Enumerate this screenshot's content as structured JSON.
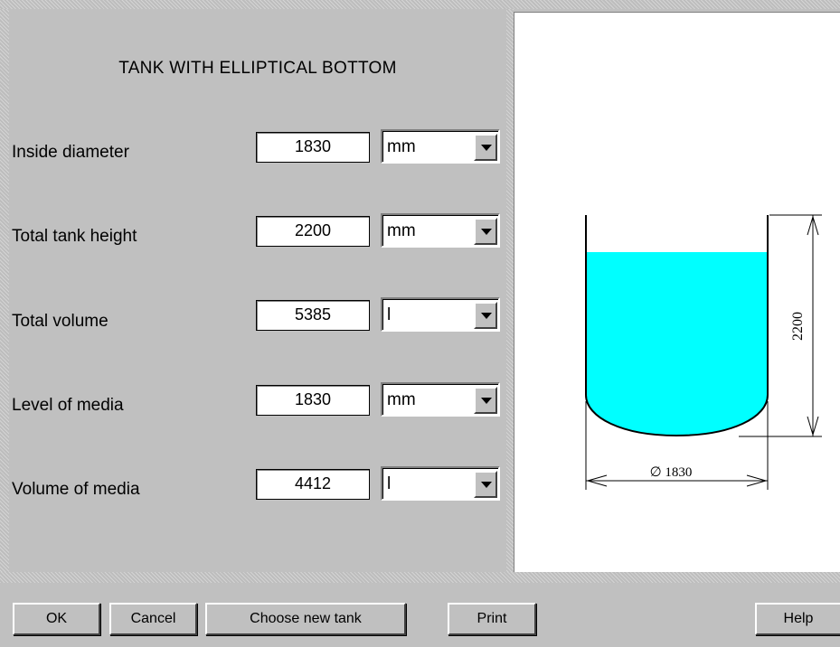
{
  "dialog": {
    "title": "TANK WITH ELLIPTICAL BOTTOM"
  },
  "fields": [
    {
      "label": "Inside diameter",
      "value": "1830",
      "unit": "mm"
    },
    {
      "label": "Total tank height",
      "value": "2200",
      "unit": "mm"
    },
    {
      "label": "Total volume",
      "value": "5385",
      "unit": "l"
    },
    {
      "label": "Level of media",
      "value": "1830",
      "unit": "mm"
    },
    {
      "label": "Volume of media",
      "value": "4412",
      "unit": "l"
    }
  ],
  "drawing": {
    "height_dim": "2200",
    "diameter_dim": "∅ 1830",
    "media_color": "#00ffff",
    "fill_fraction": 0.832
  },
  "buttons": {
    "ok": "OK",
    "cancel": "Cancel",
    "choose_new_tank": "Choose new tank",
    "print": "Print",
    "help": "Help"
  },
  "icons": {
    "dropdown": "chevron-down-icon"
  }
}
